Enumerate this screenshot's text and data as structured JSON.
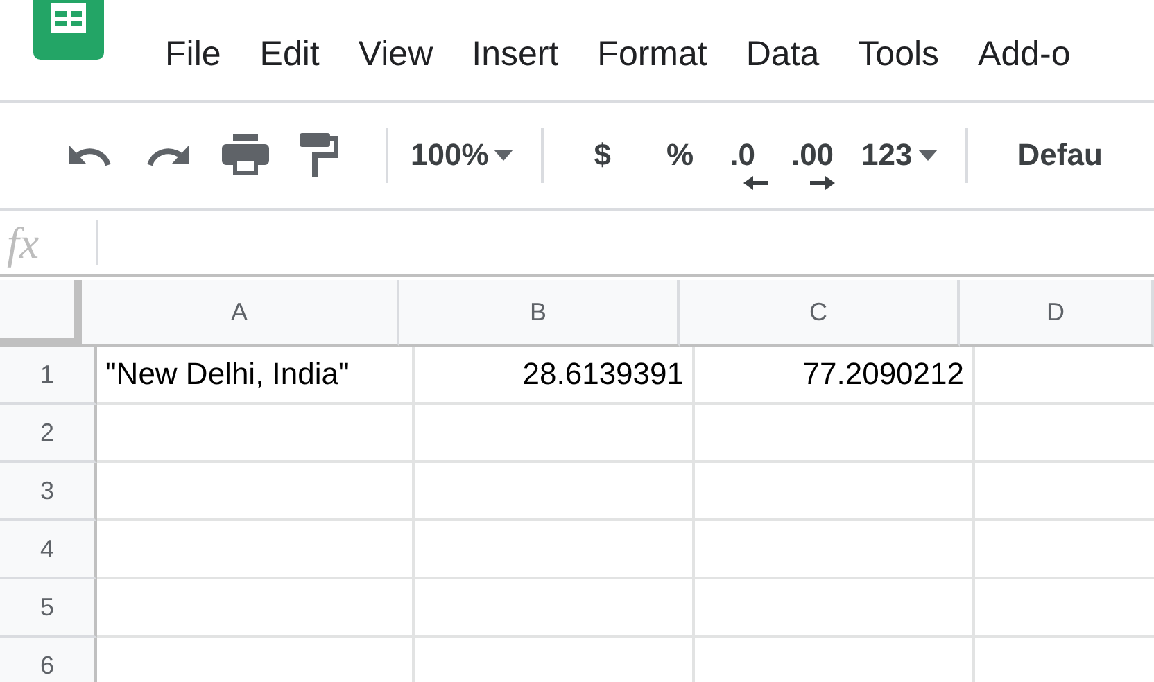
{
  "menu": [
    "File",
    "Edit",
    "View",
    "Insert",
    "Format",
    "Data",
    "Tools",
    "Add-o"
  ],
  "toolbar": [
    {
      "kind": "undo"
    },
    {
      "kind": "redo"
    },
    {
      "kind": "print"
    },
    {
      "kind": "paint"
    },
    {
      "kind": "separator"
    },
    {
      "kind": "dropdown",
      "label": "100%"
    },
    {
      "kind": "separator"
    },
    {
      "kind": "text",
      "label": "$"
    },
    {
      "kind": "text",
      "label": "%"
    },
    {
      "kind": "decrease",
      "label": ".0"
    },
    {
      "kind": "increase",
      "label": ".00"
    },
    {
      "kind": "dropdown",
      "label": "123"
    },
    {
      "kind": "separator"
    },
    {
      "kind": "text",
      "label": "Defau"
    }
  ],
  "formula_bar": {
    "label": "fx"
  },
  "columns": [
    "A",
    "B",
    "C",
    "D"
  ],
  "rows": [
    {
      "number": "1",
      "cells": [
        {
          "value": "\"New Delhi, India\"",
          "kind": "text"
        },
        {
          "value": "28.6139391",
          "kind": "number"
        },
        {
          "value": "77.2090212",
          "kind": "number"
        }
      ]
    },
    {
      "number": "2"
    },
    {
      "number": "3"
    },
    {
      "number": "4"
    },
    {
      "number": "5"
    },
    {
      "number": "6"
    }
  ]
}
